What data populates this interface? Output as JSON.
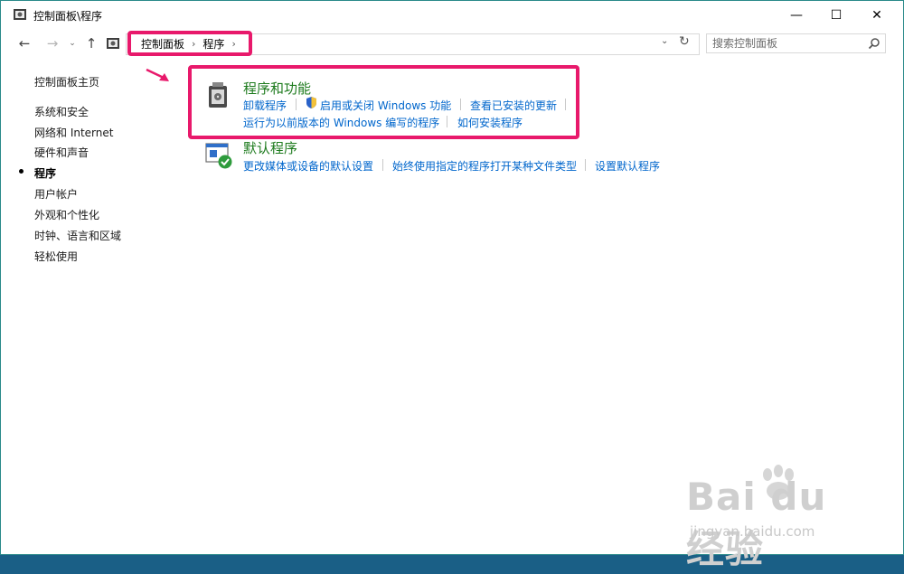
{
  "window": {
    "title": "控制面板\\程序"
  },
  "titlebar": {
    "minimize": "—",
    "maximize": "☐",
    "close": "✕"
  },
  "nav": {
    "back": "←",
    "forward": "→",
    "recent": "⌄",
    "up": "↑",
    "dropdown": "⌄",
    "refresh": "↻"
  },
  "breadcrumb": {
    "root": "控制面板",
    "current": "程序",
    "sep": "›"
  },
  "search": {
    "placeholder": "搜索控制面板"
  },
  "sidebar": {
    "items": [
      {
        "label": "控制面板主页"
      },
      {
        "label": "系统和安全"
      },
      {
        "label": "网络和 Internet"
      },
      {
        "label": "硬件和声音"
      },
      {
        "label": "程序"
      },
      {
        "label": "用户帐户"
      },
      {
        "label": "外观和个性化"
      },
      {
        "label": "时钟、语言和区域"
      },
      {
        "label": "轻松使用"
      }
    ]
  },
  "programs_features": {
    "title": "程序和功能",
    "links": {
      "uninstall": "卸载程序",
      "windows_features": "启用或关闭 Windows 功能",
      "installed_updates": "查看已安装的更新",
      "compat": "运行为以前版本的 Windows 编写的程序",
      "how_install": "如何安装程序"
    }
  },
  "default_programs": {
    "title": "默认程序",
    "links": {
      "media_defaults": "更改媒体或设备的默认设置",
      "file_type": "始终使用指定的程序打开某种文件类型",
      "set_defaults": "设置默认程序"
    }
  },
  "watermark": {
    "logo": "Bai  du经验",
    "url": "jingyan.baidu.com"
  }
}
